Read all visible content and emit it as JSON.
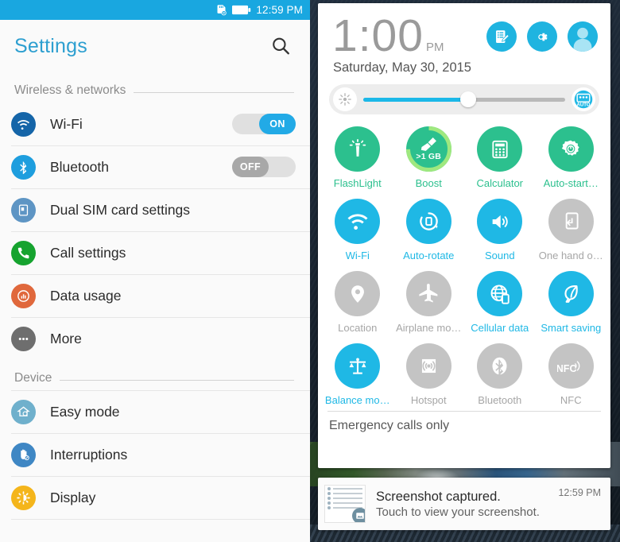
{
  "left": {
    "statusbar": {
      "time": "12:59 PM",
      "icons": [
        "sdcard-off-icon",
        "battery-icon"
      ]
    },
    "header": {
      "title": "Settings",
      "search_icon": "search-icon"
    },
    "sections": [
      {
        "label": "Wireless & networks",
        "items": [
          {
            "label": "Wi-Fi",
            "icon": "wifi-icon",
            "toggle": "ON",
            "toggle_state": "on"
          },
          {
            "label": "Bluetooth",
            "icon": "bluetooth-icon",
            "toggle": "OFF",
            "toggle_state": "off"
          },
          {
            "label": "Dual SIM card settings",
            "icon": "sim-card-icon"
          },
          {
            "label": "Call settings",
            "icon": "phone-icon"
          },
          {
            "label": "Data usage",
            "icon": "data-usage-icon"
          },
          {
            "label": "More",
            "icon": "more-dots-icon"
          }
        ]
      },
      {
        "label": "Device",
        "items": [
          {
            "label": "Easy mode",
            "icon": "easy-mode-home-icon"
          },
          {
            "label": "Interruptions",
            "icon": "hand-stop-icon"
          },
          {
            "label": "Display",
            "icon": "brightness-icon"
          }
        ]
      }
    ]
  },
  "right": {
    "clock": {
      "time": "1:00",
      "ampm": "PM",
      "date": "Saturday, May 30, 2015"
    },
    "header_buttons": [
      {
        "name": "edit-quick-settings-button",
        "icon": "note-edit-icon"
      },
      {
        "name": "settings-button",
        "icon": "gear-icon"
      },
      {
        "name": "user-profile-button",
        "icon": "avatar-icon"
      }
    ],
    "brightness": {
      "left_icon": "brightness-low-icon",
      "right_icon": "auto-brightness-icon",
      "auto_label": "AUTO",
      "value": 52
    },
    "tiles": [
      {
        "label": "FlashLight",
        "icon": "flashlight-icon",
        "state": "green"
      },
      {
        "label": "Boost",
        "icon": "boost-broom-icon",
        "state": "green",
        "badge": ">1 GB",
        "ring": true
      },
      {
        "label": "Calculator",
        "icon": "calculator-icon",
        "state": "green"
      },
      {
        "label": "Auto-start…",
        "icon": "auto-start-gear-icon",
        "state": "green"
      },
      {
        "label": "Wi-Fi",
        "icon": "wifi-icon",
        "state": "blue"
      },
      {
        "label": "Auto-rotate",
        "icon": "auto-rotate-icon",
        "state": "blue"
      },
      {
        "label": "Sound",
        "icon": "speaker-icon",
        "state": "blue"
      },
      {
        "label": "One hand o…",
        "icon": "one-hand-icon",
        "state": "gray"
      },
      {
        "label": "Location",
        "icon": "location-pin-icon",
        "state": "gray"
      },
      {
        "label": "Airplane mo…",
        "icon": "airplane-icon",
        "state": "gray"
      },
      {
        "label": "Cellular data",
        "icon": "cellular-globe-icon",
        "state": "blue"
      },
      {
        "label": "Smart saving",
        "icon": "leaf-icon",
        "state": "blue"
      },
      {
        "label": "Balance mo…",
        "icon": "balance-scale-icon",
        "state": "blue"
      },
      {
        "label": "Hotspot",
        "icon": "hotspot-icon",
        "state": "gray"
      },
      {
        "label": "Bluetooth",
        "icon": "bluetooth-icon",
        "state": "gray"
      },
      {
        "label": "NFC",
        "icon": "nfc-icon",
        "state": "gray"
      }
    ],
    "carrier_status": "Emergency calls only",
    "notification": {
      "title": "Screenshot captured.",
      "subtitle": "Touch to view your screenshot.",
      "time": "12:59 PM",
      "thumb_icon": "image-icon"
    }
  },
  "colors": {
    "status_blue": "#19a7e0",
    "accent_blue": "#1fb8e5",
    "accent_green": "#2cc08e",
    "inactive_gray": "#c4c4c4"
  }
}
